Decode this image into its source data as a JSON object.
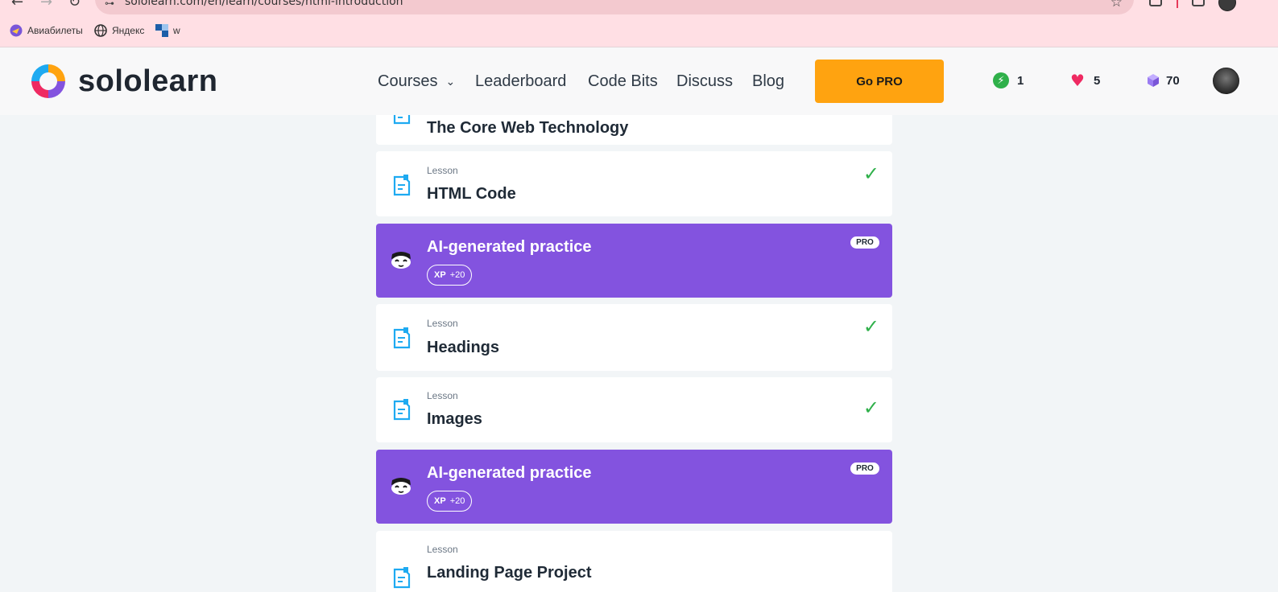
{
  "browser": {
    "url": "sololearn.com/en/learn/courses/html-introduction",
    "bookmarks": [
      {
        "label": "Авиабилеты",
        "icon": "aviasales-icon"
      },
      {
        "label": "Яндекс",
        "icon": "globe-icon"
      },
      {
        "label": "w",
        "icon": "w-site-icon"
      }
    ]
  },
  "header": {
    "logo_text": "sololearn",
    "nav": {
      "courses": "Courses",
      "leaderboard": "Leaderboard",
      "code_bits": "Code Bits",
      "discuss": "Discuss",
      "blog": "Blog"
    },
    "go_pro": "Go PRO",
    "stats": {
      "streak": "1",
      "hearts": "5",
      "bits": "70"
    }
  },
  "lessons": [
    {
      "type": "",
      "title": "The Core Web Technology",
      "completed": false,
      "kind": "lesson-partial"
    },
    {
      "type": "Lesson",
      "title": "HTML Code",
      "completed": true,
      "kind": "lesson"
    },
    {
      "type": "",
      "title": "AI-generated practice",
      "xp_label": "XP",
      "xp_value": "+20",
      "badge": "PRO",
      "kind": "practice"
    },
    {
      "type": "Lesson",
      "title": "Headings",
      "completed": true,
      "kind": "lesson"
    },
    {
      "type": "Lesson",
      "title": "Images",
      "completed": true,
      "kind": "lesson"
    },
    {
      "type": "",
      "title": "AI-generated practice",
      "xp_label": "XP",
      "xp_value": "+20",
      "badge": "PRO",
      "kind": "practice"
    },
    {
      "type": "Lesson",
      "title": "Landing Page Project",
      "completed": false,
      "kind": "lesson"
    }
  ],
  "colors": {
    "accent_orange": "#ffa310",
    "practice_purple": "#8353df",
    "check_green": "#2fb04a",
    "browser_bg": "#ffdfe4"
  }
}
